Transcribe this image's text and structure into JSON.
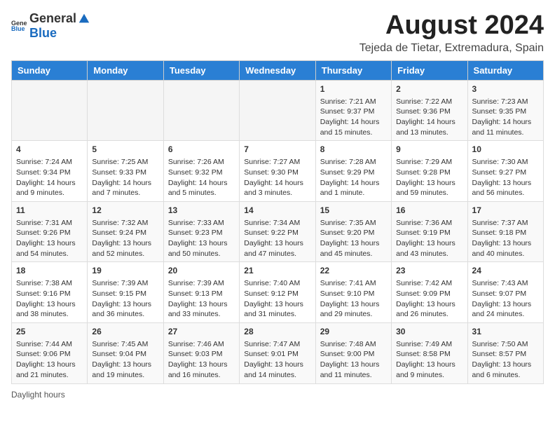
{
  "header": {
    "logo_general": "General",
    "logo_blue": "Blue",
    "main_title": "August 2024",
    "subtitle": "Tejeda de Tietar, Extremadura, Spain"
  },
  "calendar": {
    "days_of_week": [
      "Sunday",
      "Monday",
      "Tuesday",
      "Wednesday",
      "Thursday",
      "Friday",
      "Saturday"
    ],
    "weeks": [
      [
        {
          "day": "",
          "info": ""
        },
        {
          "day": "",
          "info": ""
        },
        {
          "day": "",
          "info": ""
        },
        {
          "day": "",
          "info": ""
        },
        {
          "day": "1",
          "info": "Sunrise: 7:21 AM\nSunset: 9:37 PM\nDaylight: 14 hours and 15 minutes."
        },
        {
          "day": "2",
          "info": "Sunrise: 7:22 AM\nSunset: 9:36 PM\nDaylight: 14 hours and 13 minutes."
        },
        {
          "day": "3",
          "info": "Sunrise: 7:23 AM\nSunset: 9:35 PM\nDaylight: 14 hours and 11 minutes."
        }
      ],
      [
        {
          "day": "4",
          "info": "Sunrise: 7:24 AM\nSunset: 9:34 PM\nDaylight: 14 hours and 9 minutes."
        },
        {
          "day": "5",
          "info": "Sunrise: 7:25 AM\nSunset: 9:33 PM\nDaylight: 14 hours and 7 minutes."
        },
        {
          "day": "6",
          "info": "Sunrise: 7:26 AM\nSunset: 9:32 PM\nDaylight: 14 hours and 5 minutes."
        },
        {
          "day": "7",
          "info": "Sunrise: 7:27 AM\nSunset: 9:30 PM\nDaylight: 14 hours and 3 minutes."
        },
        {
          "day": "8",
          "info": "Sunrise: 7:28 AM\nSunset: 9:29 PM\nDaylight: 14 hours and 1 minute."
        },
        {
          "day": "9",
          "info": "Sunrise: 7:29 AM\nSunset: 9:28 PM\nDaylight: 13 hours and 59 minutes."
        },
        {
          "day": "10",
          "info": "Sunrise: 7:30 AM\nSunset: 9:27 PM\nDaylight: 13 hours and 56 minutes."
        }
      ],
      [
        {
          "day": "11",
          "info": "Sunrise: 7:31 AM\nSunset: 9:26 PM\nDaylight: 13 hours and 54 minutes."
        },
        {
          "day": "12",
          "info": "Sunrise: 7:32 AM\nSunset: 9:24 PM\nDaylight: 13 hours and 52 minutes."
        },
        {
          "day": "13",
          "info": "Sunrise: 7:33 AM\nSunset: 9:23 PM\nDaylight: 13 hours and 50 minutes."
        },
        {
          "day": "14",
          "info": "Sunrise: 7:34 AM\nSunset: 9:22 PM\nDaylight: 13 hours and 47 minutes."
        },
        {
          "day": "15",
          "info": "Sunrise: 7:35 AM\nSunset: 9:20 PM\nDaylight: 13 hours and 45 minutes."
        },
        {
          "day": "16",
          "info": "Sunrise: 7:36 AM\nSunset: 9:19 PM\nDaylight: 13 hours and 43 minutes."
        },
        {
          "day": "17",
          "info": "Sunrise: 7:37 AM\nSunset: 9:18 PM\nDaylight: 13 hours and 40 minutes."
        }
      ],
      [
        {
          "day": "18",
          "info": "Sunrise: 7:38 AM\nSunset: 9:16 PM\nDaylight: 13 hours and 38 minutes."
        },
        {
          "day": "19",
          "info": "Sunrise: 7:39 AM\nSunset: 9:15 PM\nDaylight: 13 hours and 36 minutes."
        },
        {
          "day": "20",
          "info": "Sunrise: 7:39 AM\nSunset: 9:13 PM\nDaylight: 13 hours and 33 minutes."
        },
        {
          "day": "21",
          "info": "Sunrise: 7:40 AM\nSunset: 9:12 PM\nDaylight: 13 hours and 31 minutes."
        },
        {
          "day": "22",
          "info": "Sunrise: 7:41 AM\nSunset: 9:10 PM\nDaylight: 13 hours and 29 minutes."
        },
        {
          "day": "23",
          "info": "Sunrise: 7:42 AM\nSunset: 9:09 PM\nDaylight: 13 hours and 26 minutes."
        },
        {
          "day": "24",
          "info": "Sunrise: 7:43 AM\nSunset: 9:07 PM\nDaylight: 13 hours and 24 minutes."
        }
      ],
      [
        {
          "day": "25",
          "info": "Sunrise: 7:44 AM\nSunset: 9:06 PM\nDaylight: 13 hours and 21 minutes."
        },
        {
          "day": "26",
          "info": "Sunrise: 7:45 AM\nSunset: 9:04 PM\nDaylight: 13 hours and 19 minutes."
        },
        {
          "day": "27",
          "info": "Sunrise: 7:46 AM\nSunset: 9:03 PM\nDaylight: 13 hours and 16 minutes."
        },
        {
          "day": "28",
          "info": "Sunrise: 7:47 AM\nSunset: 9:01 PM\nDaylight: 13 hours and 14 minutes."
        },
        {
          "day": "29",
          "info": "Sunrise: 7:48 AM\nSunset: 9:00 PM\nDaylight: 13 hours and 11 minutes."
        },
        {
          "day": "30",
          "info": "Sunrise: 7:49 AM\nSunset: 8:58 PM\nDaylight: 13 hours and 9 minutes."
        },
        {
          "day": "31",
          "info": "Sunrise: 7:50 AM\nSunset: 8:57 PM\nDaylight: 13 hours and 6 minutes."
        }
      ]
    ]
  },
  "footer": {
    "note": "Daylight hours"
  }
}
